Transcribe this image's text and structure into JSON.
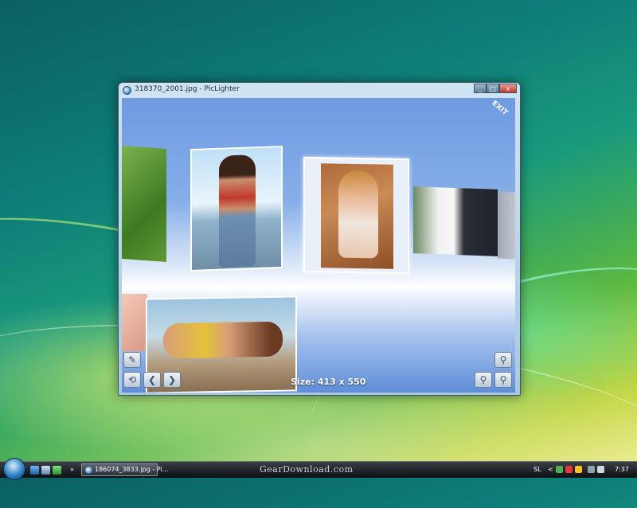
{
  "window": {
    "title": "318370_2001.jpg - PicLighter",
    "controls": {
      "minimize": "_",
      "maximize": "□",
      "close": "x"
    }
  },
  "viewer": {
    "exit_label": "EXIT",
    "size_label": "Size: 413 x 550",
    "buttons": {
      "edit": "✎",
      "rotate": "⟲",
      "previous": "❮",
      "next": "❯",
      "zoom": "⚲",
      "zoom_out": "⚲",
      "zoom_in": "⚲"
    }
  },
  "taskbar": {
    "quicklaunch_more": "»",
    "task_title": "186074_3833.jpg - Pi...",
    "watermark": "GearDownload.com",
    "tray_language": "SL",
    "tray_chevron": "<",
    "clock": "7:37"
  },
  "colors": {
    "viewer_top": "#6f9ae0",
    "viewer_bottom": "#5f8ed8",
    "taskbar": "#0c0f12"
  }
}
